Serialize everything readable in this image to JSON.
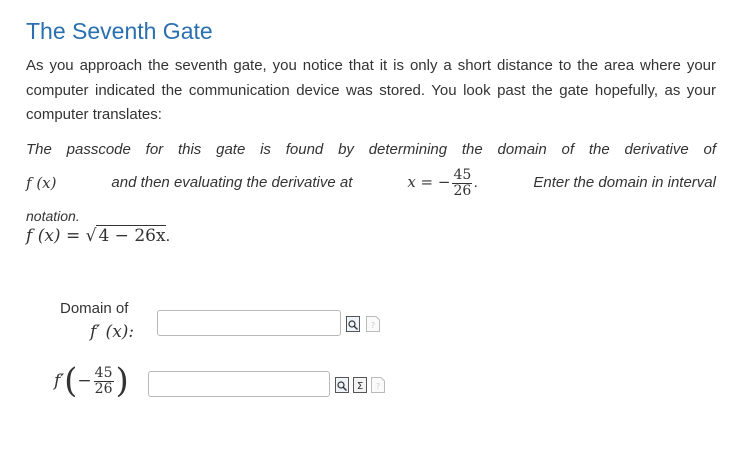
{
  "heading": "The Seventh Gate",
  "story": "As you approach the seventh gate, you notice that it is only a short distance to the area where your computer indicated the communication device was stored. You look past the gate hopefully, as your computer translates:",
  "task": {
    "part1": "The passcode for this gate is found by determining the domain of the derivative of",
    "f_of_x": "f (x)",
    "part2": "and then evaluating the derivative at",
    "x_eq": "x = −",
    "num": "45",
    "den": "26",
    "period": ".",
    "part3": "Enter the domain in interval",
    "part4": "notation."
  },
  "function_def": {
    "lhs": "f (x) = ",
    "radical": "√",
    "radicand": "4 − 26x",
    "end": "."
  },
  "answer1": {
    "label_line1": "Domain of",
    "label_line2": "f′ (x):",
    "value": "",
    "icons": [
      "preview-icon",
      "help-icon"
    ]
  },
  "answer2": {
    "label_fprime": "f′",
    "open_paren": "(",
    "minus": "−",
    "num": "45",
    "den": "26",
    "close_paren": ")",
    "value": "",
    "icons": [
      "preview-icon",
      "equation-editor-icon",
      "help-icon"
    ]
  }
}
